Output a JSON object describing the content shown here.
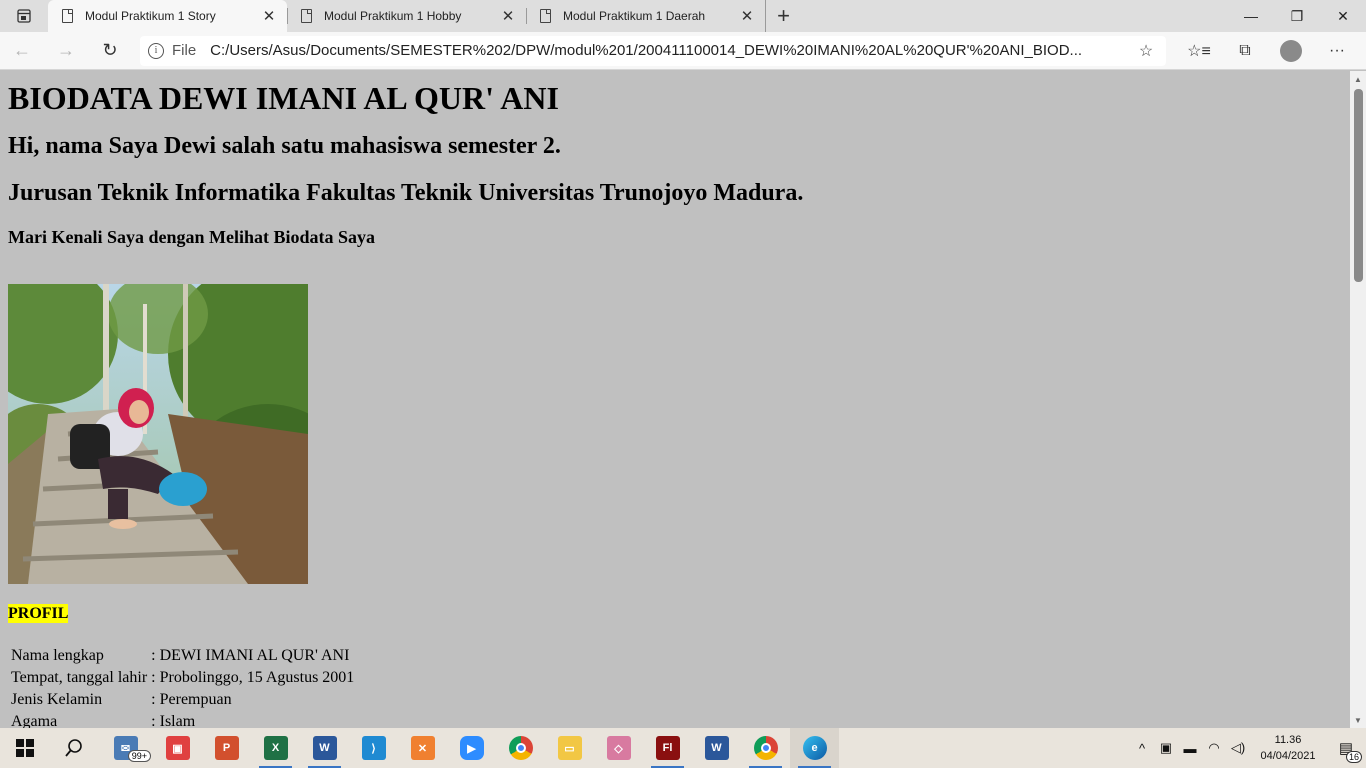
{
  "browser": {
    "tabs": [
      {
        "title": "Modul Praktikum 1 Story",
        "active": true
      },
      {
        "title": "Modul Praktikum 1 Hobby",
        "active": false
      },
      {
        "title": "Modul Praktikum 1 Daerah",
        "active": false
      }
    ],
    "address": {
      "scheme": "File",
      "url": "C:/Users/Asus/Documents/SEMESTER%202/DPW/modul%201/200411100014_DEWI%20IMANI%20AL%20QUR'%20ANI_BIOD..."
    }
  },
  "page": {
    "background": "#c0c0c0",
    "heading": "BIODATA DEWI IMANI AL QUR' ANI",
    "intro_line1": "Hi, nama Saya Dewi salah satu mahasiswa semester 2.",
    "intro_line2": "Jurusan Teknik Informatika Fakultas Teknik Universitas Trunojoyo Madura.",
    "subheading": "Mari Kenali Saya dengan Melihat Biodata Saya",
    "section_label": "PROFIL",
    "section_highlight": "#ffff00",
    "profile_rows": [
      {
        "label": "Nama lengkap",
        "value": ": DEWI IMANI AL QUR' ANI"
      },
      {
        "label": "Tempat, tanggal lahir",
        "value": ": Probolinggo, 15 Agustus 2001"
      },
      {
        "label": "Jenis Kelamin",
        "value": ": Perempuan"
      },
      {
        "label": "Agama",
        "value": ": Islam"
      }
    ]
  },
  "taskbar": {
    "apps": [
      {
        "name": "mail-icon",
        "badge": "99+"
      },
      {
        "name": "gift-icon"
      },
      {
        "name": "powerpoint-icon"
      },
      {
        "name": "excel-icon"
      },
      {
        "name": "word-icon"
      },
      {
        "name": "vscode-icon"
      },
      {
        "name": "xampp-icon"
      },
      {
        "name": "zoom-icon"
      },
      {
        "name": "chrome-icon"
      },
      {
        "name": "file-explorer-icon"
      },
      {
        "name": "photos-icon"
      },
      {
        "name": "flash-icon"
      },
      {
        "name": "word-doc-icon"
      },
      {
        "name": "chrome-profile-icon"
      },
      {
        "name": "edge-icon"
      }
    ],
    "time": "11.36",
    "date": "04/04/2021",
    "notification_count": "16"
  }
}
